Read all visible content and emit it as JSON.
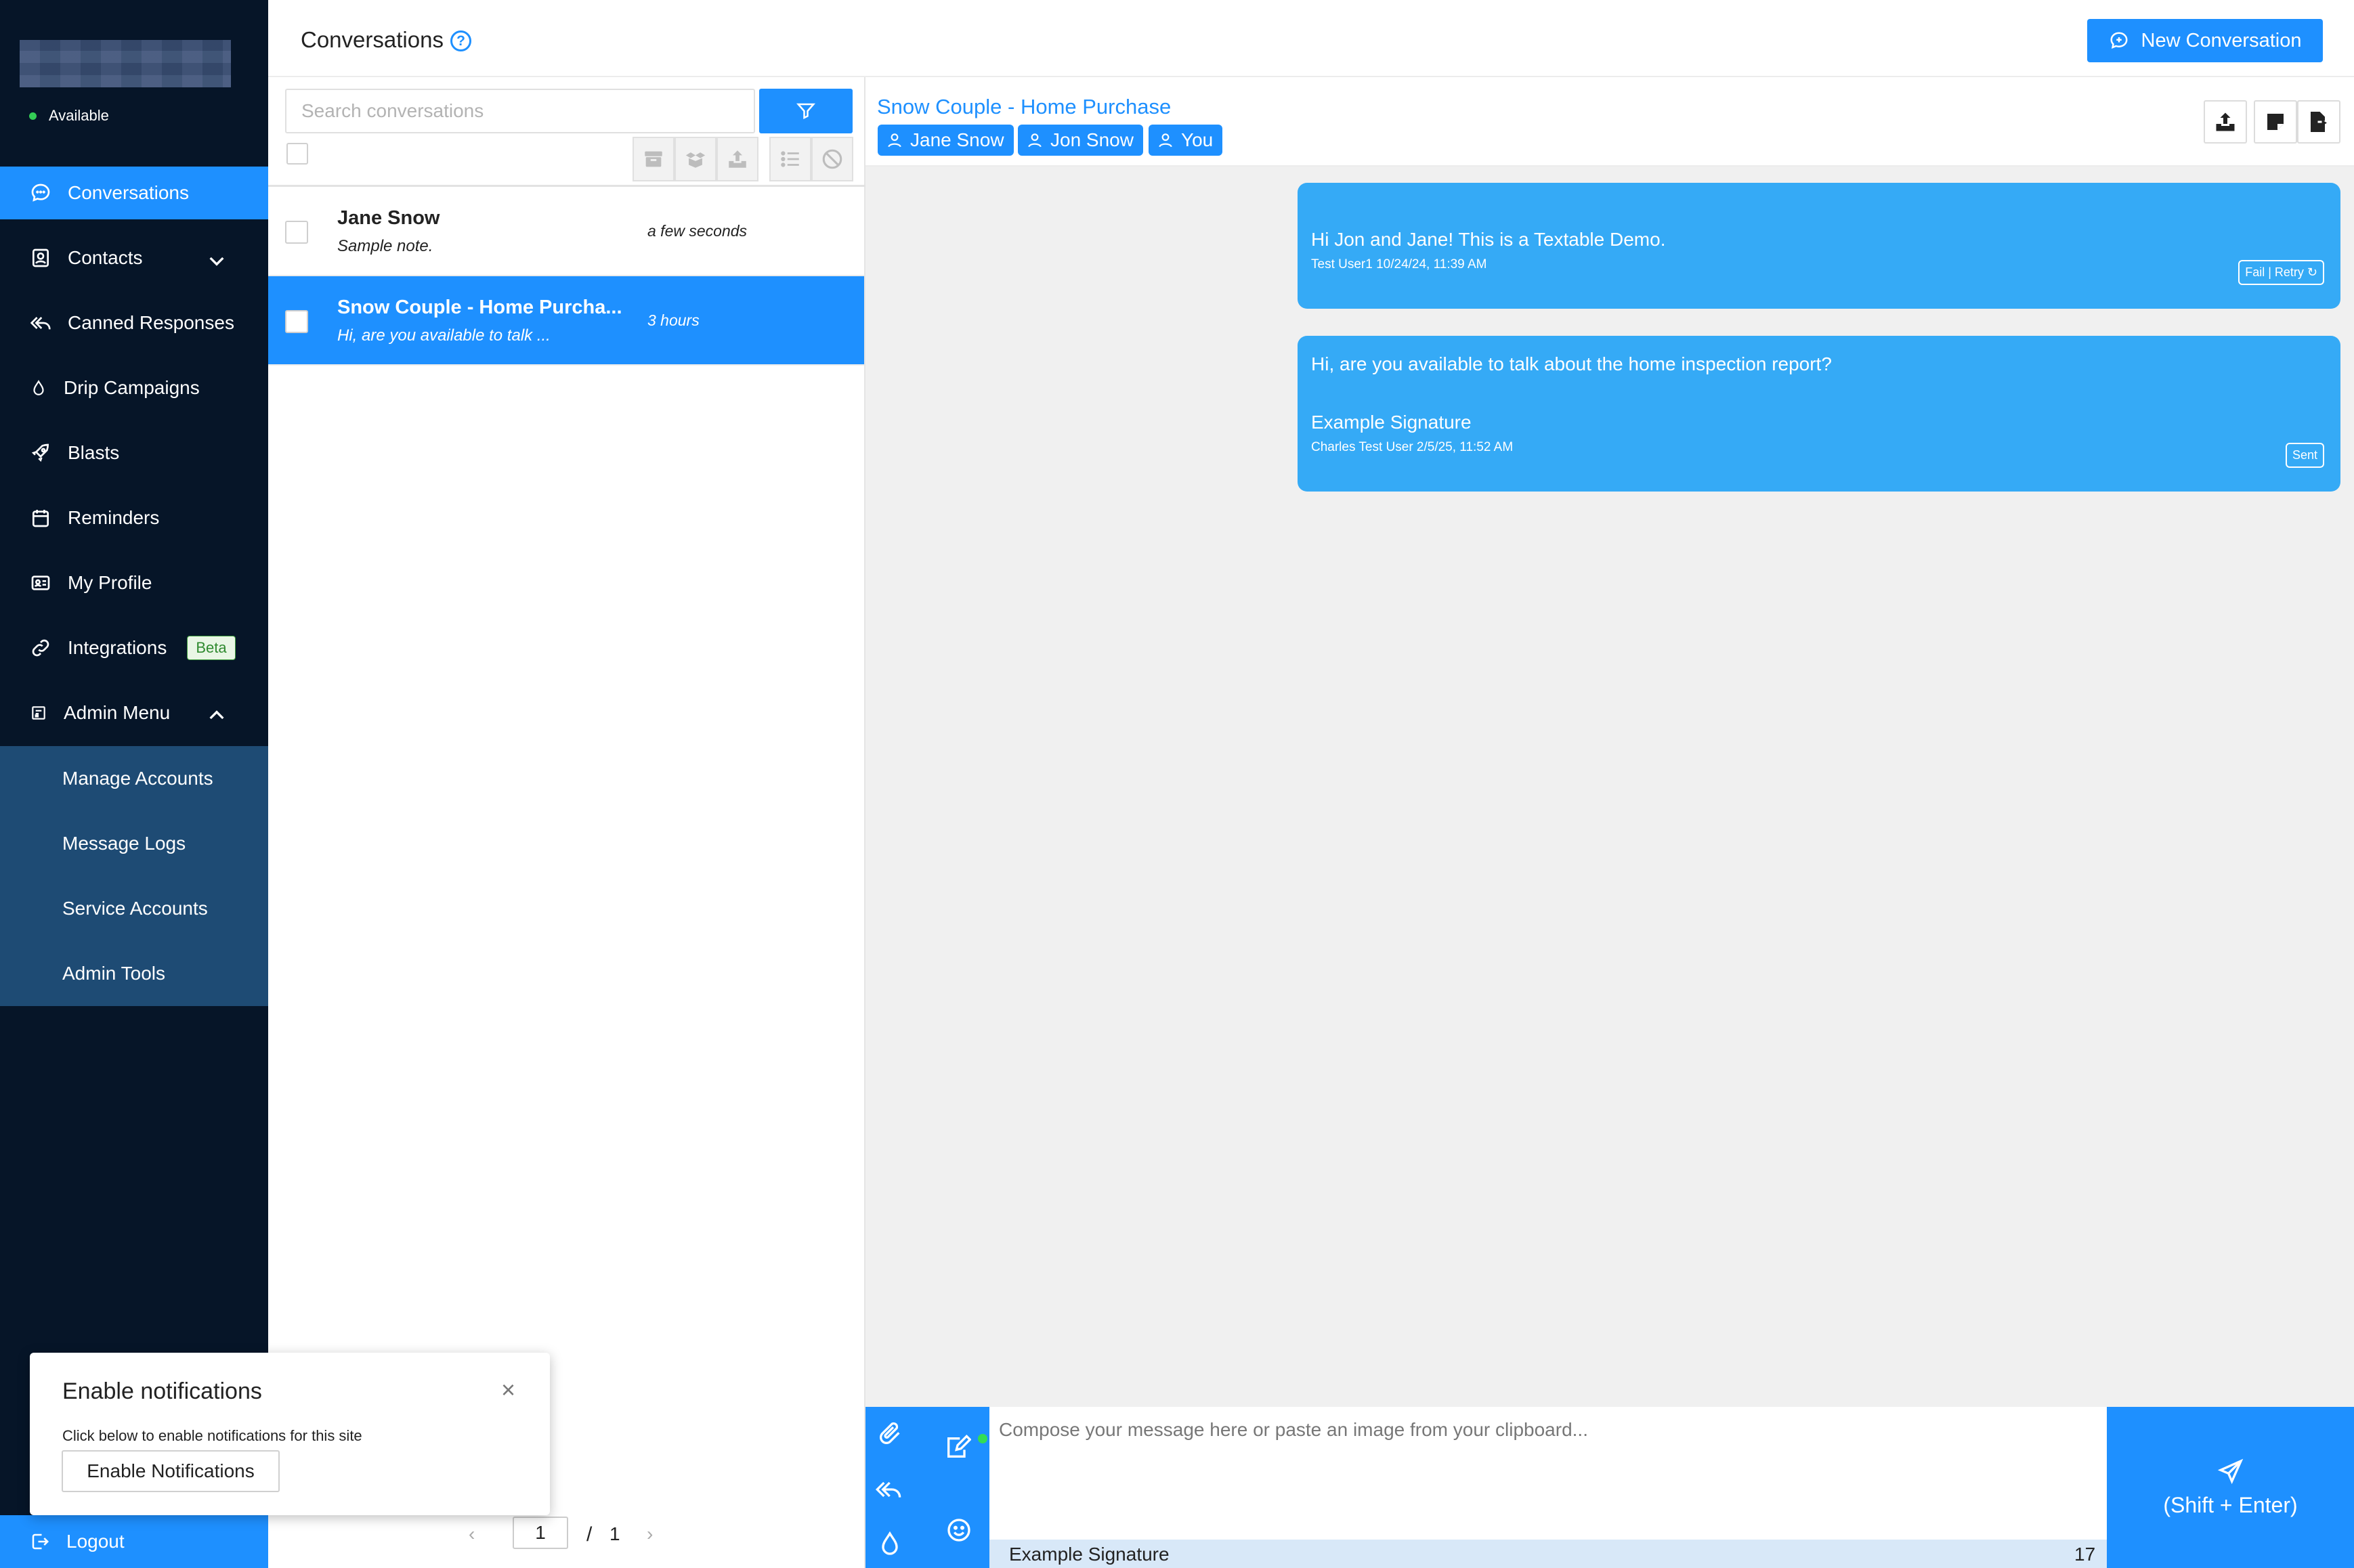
{
  "sidebar": {
    "status": "Available",
    "items": [
      {
        "label": "Conversations",
        "icon": "chat-icon"
      },
      {
        "label": "Contacts",
        "icon": "contacts-icon"
      },
      {
        "label": "Canned Responses",
        "icon": "reply-all-icon"
      },
      {
        "label": "Drip Campaigns",
        "icon": "droplet-icon"
      },
      {
        "label": "Blasts",
        "icon": "rocket-icon"
      },
      {
        "label": "Reminders",
        "icon": "calendar-icon"
      },
      {
        "label": "My Profile",
        "icon": "id-card-icon"
      },
      {
        "label": "Integrations",
        "icon": "link-icon",
        "badge": "Beta"
      },
      {
        "label": "Admin Menu",
        "icon": "admin-icon"
      }
    ],
    "admin_items": [
      "Manage Accounts",
      "Message Logs",
      "Service Accounts",
      "Admin Tools"
    ],
    "logout": "Logout"
  },
  "header": {
    "title": "Conversations",
    "help": "?",
    "new_conversation": "New Conversation"
  },
  "list": {
    "search_placeholder": "Search conversations",
    "conversations": [
      {
        "name": "Jane Snow",
        "note": "Sample note.",
        "time": "a few seconds",
        "selected": false
      },
      {
        "name": "Snow Couple - Home Purcha...",
        "note": "Hi, are you available to talk ...",
        "time": "3 hours",
        "selected": true
      }
    ],
    "pager": {
      "current": "1",
      "separator": "/",
      "total": "1",
      "prev": "‹",
      "next": "›"
    }
  },
  "chat": {
    "title": "Snow Couple - Home Purchase",
    "participants": [
      "Jane Snow",
      "Jon Snow",
      "You"
    ],
    "messages": [
      {
        "text": "Hi Jon and Jane! This is a Textable Demo.",
        "meta": "Test User1 10/24/24, 11:39 AM",
        "status": "Fail | Retry ↻"
      },
      {
        "text": "Hi, are you available to talk about the home inspection report?",
        "signature": "Example Signature",
        "meta": "Charles Test User 2/5/25, 11:52 AM",
        "status": "Sent"
      }
    ],
    "compose_placeholder": "Compose your message here or paste an image from your clipboard...",
    "signature": "Example Signature",
    "char_count": "17",
    "send_label": "(Shift + Enter)"
  },
  "notification": {
    "title": "Enable notifications",
    "close": "×",
    "body": "Click below to enable notifications for this site",
    "button": "Enable Notifications"
  },
  "colors": {
    "sidebar_bg": "#061528",
    "accent": "#1e90ff",
    "submenu_bg": "#1e4b74",
    "bubble": "#35aaf6",
    "chat_bg": "#f0f0f0"
  }
}
